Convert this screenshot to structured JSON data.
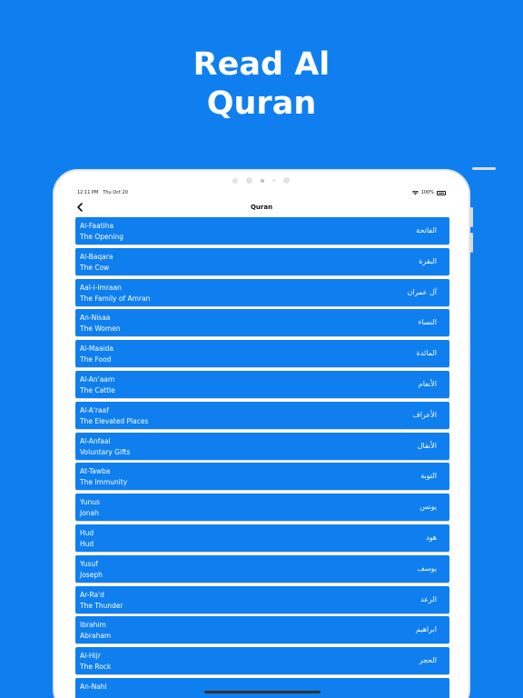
{
  "hero": {
    "line1": "Read Al",
    "line2": "Quran"
  },
  "status_bar": {
    "time": "12:11 PM",
    "date": "Thu Oct 20",
    "battery": "100%"
  },
  "nav": {
    "title": "Quran",
    "back_icon": "chevron-left-icon"
  },
  "colors": {
    "background": "#0f7ff0",
    "row": "#0f7ff0",
    "text": "#ffffff"
  },
  "surahs": [
    {
      "name": "Al-Faatiha",
      "meaning": "The Opening",
      "arabic": "الفاتحة"
    },
    {
      "name": "Al-Baqara",
      "meaning": "The Cow",
      "arabic": "البقرة"
    },
    {
      "name": "Aal-i-Imraan",
      "meaning": "The Family of Amran",
      "arabic": "آل عمران"
    },
    {
      "name": "An-Nisaa",
      "meaning": "The Women",
      "arabic": "النساء"
    },
    {
      "name": "Al-Maaida",
      "meaning": "The Food",
      "arabic": "المائدة"
    },
    {
      "name": "Al-An'aam",
      "meaning": "The Cattle",
      "arabic": "الأنعام"
    },
    {
      "name": "Al-A'raaf",
      "meaning": "The Elevated Places",
      "arabic": "الأعراف"
    },
    {
      "name": "Al-Anfaal",
      "meaning": "Voluntary Gifts",
      "arabic": "الأنفال"
    },
    {
      "name": "At-Tawba",
      "meaning": "The Immunity",
      "arabic": "التوبة"
    },
    {
      "name": "Yunus",
      "meaning": "Jonah",
      "arabic": "يونس"
    },
    {
      "name": "Hud",
      "meaning": "Hud",
      "arabic": "هود"
    },
    {
      "name": "Yusuf",
      "meaning": "Joseph",
      "arabic": "يوسف"
    },
    {
      "name": "Ar-Ra'd",
      "meaning": "The Thunder",
      "arabic": "الرعد"
    },
    {
      "name": "Ibrahim",
      "meaning": "Abraham",
      "arabic": "ابراهيم"
    },
    {
      "name": "Al-Hijr",
      "meaning": "The Rock",
      "arabic": "الحجر"
    },
    {
      "name": "An-Nahl",
      "meaning": "",
      "arabic": ""
    }
  ]
}
